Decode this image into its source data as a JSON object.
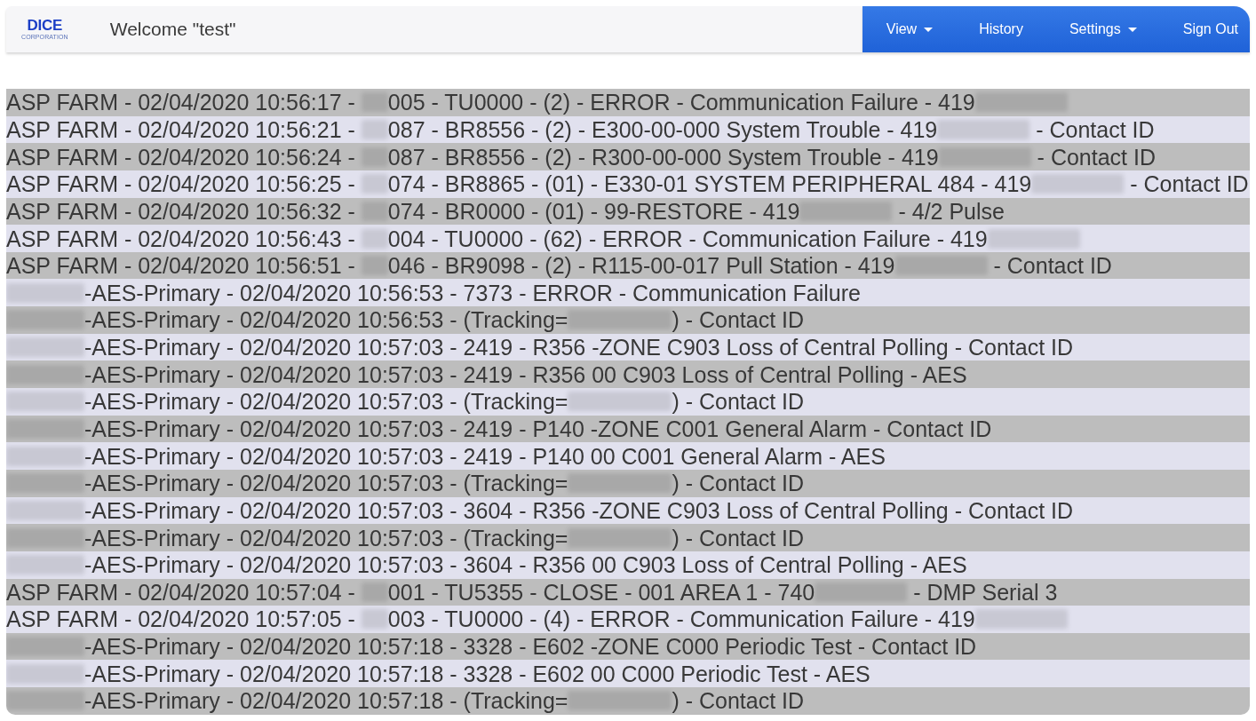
{
  "header": {
    "logo": {
      "name": "DICE",
      "subtitle": "CORPORATION"
    },
    "welcome": "Welcome \"test\"",
    "nav": [
      {
        "label": "View",
        "has_menu": true
      },
      {
        "label": "History",
        "has_menu": false
      },
      {
        "label": "Settings",
        "has_menu": true
      },
      {
        "label": "Sign Out",
        "has_menu": false
      }
    ]
  },
  "log": {
    "rows": [
      {
        "segments": [
          {
            "kind": "text",
            "text": "ASP FARM - 02/04/2020 10:56:17 -"
          },
          {
            "kind": "redacted_account"
          },
          {
            "kind": "text",
            "text": "005 - TU0000 - (2) - ERROR - Communication Failure - 419"
          },
          {
            "kind": "redacted_phone"
          }
        ]
      },
      {
        "segments": [
          {
            "kind": "text",
            "text": "ASP FARM - 02/04/2020 10:56:21 -"
          },
          {
            "kind": "redacted_account"
          },
          {
            "kind": "text",
            "text": "087 - BR8556 - (2) - E300-00-000 System Trouble - 419"
          },
          {
            "kind": "redacted_phone"
          },
          {
            "kind": "text",
            "text": "- Contact ID"
          }
        ]
      },
      {
        "segments": [
          {
            "kind": "text",
            "text": "ASP FARM - 02/04/2020 10:56:24 -"
          },
          {
            "kind": "redacted_account"
          },
          {
            "kind": "text",
            "text": "087 - BR8556 - (2) - R300-00-000 System Trouble - 419"
          },
          {
            "kind": "redacted_phone"
          },
          {
            "kind": "text",
            "text": "- Contact ID"
          }
        ]
      },
      {
        "segments": [
          {
            "kind": "text",
            "text": "ASP FARM - 02/04/2020 10:56:25 -"
          },
          {
            "kind": "redacted_account"
          },
          {
            "kind": "text",
            "text": "074 - BR8865 - (01) - E330-01 SYSTEM PERIPHERAL 484 - 419"
          },
          {
            "kind": "redacted_phone"
          },
          {
            "kind": "text",
            "text": "- Contact ID"
          }
        ]
      },
      {
        "segments": [
          {
            "kind": "text",
            "text": "ASP FARM - 02/04/2020 10:56:32 -"
          },
          {
            "kind": "redacted_account"
          },
          {
            "kind": "text",
            "text": "074 - BR0000 - (01) - 99-RESTORE - 419"
          },
          {
            "kind": "redacted_phone"
          },
          {
            "kind": "text",
            "text": "- 4/2 Pulse"
          }
        ]
      },
      {
        "segments": [
          {
            "kind": "text",
            "text": "ASP FARM - 02/04/2020 10:56:43 -"
          },
          {
            "kind": "redacted_account"
          },
          {
            "kind": "text",
            "text": "004 - TU0000 - (62) - ERROR - Communication Failure - 419"
          },
          {
            "kind": "redacted_phone"
          }
        ]
      },
      {
        "segments": [
          {
            "kind": "text",
            "text": "ASP FARM - 02/04/2020 10:56:51 -"
          },
          {
            "kind": "redacted_account"
          },
          {
            "kind": "text",
            "text": "046 - BR9098 - (2) - R115-00-017 Pull Station - 419"
          },
          {
            "kind": "redacted_phone"
          },
          {
            "kind": "text",
            "text": "- Contact ID"
          }
        ]
      },
      {
        "segments": [
          {
            "kind": "redacted_receiver"
          },
          {
            "kind": "text",
            "text": "-AES-Primary - 02/04/2020 10:56:53 - 7373 - ERROR - Communication Failure"
          }
        ]
      },
      {
        "segments": [
          {
            "kind": "redacted_receiver"
          },
          {
            "kind": "text",
            "text": "-AES-Primary - 02/04/2020 10:56:53 - (Tracking="
          },
          {
            "kind": "redacted_tracking"
          },
          {
            "kind": "text",
            "text": ") - Contact ID"
          }
        ]
      },
      {
        "segments": [
          {
            "kind": "redacted_receiver"
          },
          {
            "kind": "text",
            "text": "-AES-Primary - 02/04/2020 10:57:03 - 2419 - R356 -ZONE C903 Loss of Central Polling - Contact ID"
          }
        ]
      },
      {
        "segments": [
          {
            "kind": "redacted_receiver"
          },
          {
            "kind": "text",
            "text": "-AES-Primary - 02/04/2020 10:57:03 - 2419 - R356 00 C903 Loss of Central Polling - AES"
          }
        ]
      },
      {
        "segments": [
          {
            "kind": "redacted_receiver"
          },
          {
            "kind": "text",
            "text": "-AES-Primary - 02/04/2020 10:57:03 - (Tracking="
          },
          {
            "kind": "redacted_tracking"
          },
          {
            "kind": "text",
            "text": ") - Contact ID"
          }
        ]
      },
      {
        "segments": [
          {
            "kind": "redacted_receiver"
          },
          {
            "kind": "text",
            "text": "-AES-Primary - 02/04/2020 10:57:03 - 2419 - P140 -ZONE C001 General Alarm - Contact ID"
          }
        ]
      },
      {
        "segments": [
          {
            "kind": "redacted_receiver"
          },
          {
            "kind": "text",
            "text": "-AES-Primary - 02/04/2020 10:57:03 - 2419 - P140 00 C001 General Alarm - AES"
          }
        ]
      },
      {
        "segments": [
          {
            "kind": "redacted_receiver"
          },
          {
            "kind": "text",
            "text": "-AES-Primary - 02/04/2020 10:57:03 - (Tracking="
          },
          {
            "kind": "redacted_tracking"
          },
          {
            "kind": "text",
            "text": ") - Contact ID"
          }
        ]
      },
      {
        "segments": [
          {
            "kind": "redacted_receiver"
          },
          {
            "kind": "text",
            "text": "-AES-Primary - 02/04/2020 10:57:03 - 3604 - R356 -ZONE C903 Loss of Central Polling - Contact ID"
          }
        ]
      },
      {
        "segments": [
          {
            "kind": "redacted_receiver"
          },
          {
            "kind": "text",
            "text": "-AES-Primary - 02/04/2020 10:57:03 - (Tracking="
          },
          {
            "kind": "redacted_tracking"
          },
          {
            "kind": "text",
            "text": ") - Contact ID"
          }
        ]
      },
      {
        "segments": [
          {
            "kind": "redacted_receiver"
          },
          {
            "kind": "text",
            "text": "-AES-Primary - 02/04/2020 10:57:03 - 3604 - R356 00 C903 Loss of Central Polling - AES"
          }
        ]
      },
      {
        "segments": [
          {
            "kind": "text",
            "text": "ASP FARM - 02/04/2020 10:57:04 -"
          },
          {
            "kind": "redacted_account"
          },
          {
            "kind": "text",
            "text": "001 - TU5355 - CLOSE - 001 AREA 1 - 740"
          },
          {
            "kind": "redacted_phone"
          },
          {
            "kind": "text",
            "text": "- DMP Serial 3"
          }
        ]
      },
      {
        "segments": [
          {
            "kind": "text",
            "text": "ASP FARM - 02/04/2020 10:57:05 -"
          },
          {
            "kind": "redacted_account"
          },
          {
            "kind": "text",
            "text": "003 - TU0000 - (4) - ERROR - Communication Failure - 419"
          },
          {
            "kind": "redacted_phone"
          }
        ]
      },
      {
        "segments": [
          {
            "kind": "redacted_receiver"
          },
          {
            "kind": "text",
            "text": "-AES-Primary - 02/04/2020 10:57:18 - 3328 - E602 -ZONE C000 Periodic Test - Contact ID"
          }
        ]
      },
      {
        "segments": [
          {
            "kind": "redacted_receiver"
          },
          {
            "kind": "text",
            "text": "-AES-Primary - 02/04/2020 10:57:18 - 3328 - E602 00 C000 Periodic Test - AES"
          }
        ]
      },
      {
        "segments": [
          {
            "kind": "redacted_receiver"
          },
          {
            "kind": "text",
            "text": "-AES-Primary - 02/04/2020 10:57:18 - (Tracking="
          },
          {
            "kind": "redacted_tracking"
          },
          {
            "kind": "text",
            "text": ") - Contact ID"
          }
        ]
      }
    ]
  }
}
